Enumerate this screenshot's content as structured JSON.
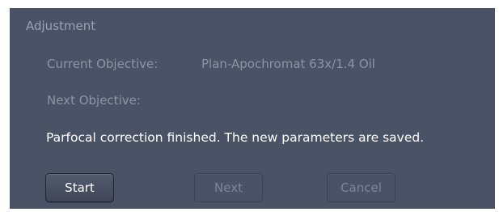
{
  "group": {
    "title": "Adjustment"
  },
  "current_objective": {
    "label": "Current Objective:",
    "value": "Plan-Apochromat 63x/1.4 Oil"
  },
  "next_objective": {
    "label": "Next Objective:",
    "value": ""
  },
  "status_message": "Parfocal correction finished. The new parameters are saved.",
  "buttons": {
    "start": "Start",
    "next": "Next",
    "cancel": "Cancel"
  },
  "colors": {
    "panel_background": "#4a5266",
    "muted_text": "#8d94a3",
    "active_text": "#ffffff"
  }
}
